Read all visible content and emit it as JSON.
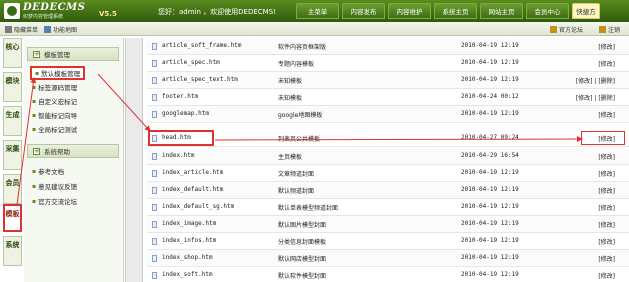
{
  "header": {
    "brand": "DEDECMS",
    "brand_sub": "织梦内容管理系统",
    "version": "V5.5",
    "welcome": "您好：admin ，欢迎使用DEDECMS!",
    "nav": [
      "主菜单",
      "内容发布",
      "内容维护",
      "系统主页",
      "网站主页",
      "会员中心",
      "快捷方"
    ]
  },
  "subbar": {
    "hide_menu": "隐藏菜单",
    "site_map": "功能地图",
    "forum": "官方论坛",
    "logout": "注销"
  },
  "vertical_tabs": [
    "核心",
    "模块",
    "生成",
    "采集",
    "会员",
    "模板",
    "系统"
  ],
  "sidebar": {
    "section1": "模板管理",
    "items1": [
      "默认模板管理",
      "标签源码管理",
      "自定义宏标记",
      "智能标记向导",
      "全局标记测试"
    ],
    "section2": "系统帮助",
    "items2": [
      "参考文档",
      "意见建议反馈",
      "官方交流论坛"
    ]
  },
  "files": [
    {
      "name": "article_soft_frame.htm",
      "desc": "软件内容页框架版",
      "date": "2010-04-19 12:19",
      "actions": "[修改]"
    },
    {
      "name": "article_spec.htm",
      "desc": "专题内容模板",
      "date": "2010-04-19 12:19",
      "actions": "[修改]"
    },
    {
      "name": "article_spec_text.htm",
      "desc": "未知模板",
      "date": "2010-04-19 12:19",
      "actions": "[修改] | [删除]"
    },
    {
      "name": "footer.htm",
      "desc": "未知模板",
      "date": "2010-04-24 00:12",
      "actions": "[修改] | [删除]"
    },
    {
      "name": "googlemap.htm",
      "desc": "google地图模板",
      "date": "2010-04-19 12:19",
      "actions": "[修改]"
    },
    {
      "name": "head.htm",
      "desc": "列表页公共模板",
      "date": "2010-04-27 09:24",
      "actions": "[修改]"
    },
    {
      "name": "index.htm",
      "desc": "主页模板",
      "date": "2010-04-29 16:54",
      "actions": "[修改]"
    },
    {
      "name": "index_article.htm",
      "desc": "文章频道封面",
      "date": "2010-04-19 12:19",
      "actions": "[修改]"
    },
    {
      "name": "index_default.htm",
      "desc": "默认频道封面",
      "date": "2010-04-19 12:19",
      "actions": "[修改]"
    },
    {
      "name": "index_default_sg.htm",
      "desc": "默认单表模型频道封面",
      "date": "2010-04-19 12:19",
      "actions": "[修改]"
    },
    {
      "name": "index_image.htm",
      "desc": "默认图片模型封面",
      "date": "2010-04-19 12:19",
      "actions": "[修改]"
    },
    {
      "name": "index_infos.htm",
      "desc": "分类信息封面模板",
      "date": "2010-04-19 12:19",
      "actions": "[修改]"
    },
    {
      "name": "index_shop.htm",
      "desc": "默认网店模型封面",
      "date": "2010-04-19 12:19",
      "actions": "[修改]"
    },
    {
      "name": "index_soft.htm",
      "desc": "默认软件模型封面",
      "date": "2010-04-19 12:19",
      "actions": "[修改]"
    }
  ],
  "colors": {
    "header_green": "#3e6c16",
    "highlight_red": "#d33"
  }
}
